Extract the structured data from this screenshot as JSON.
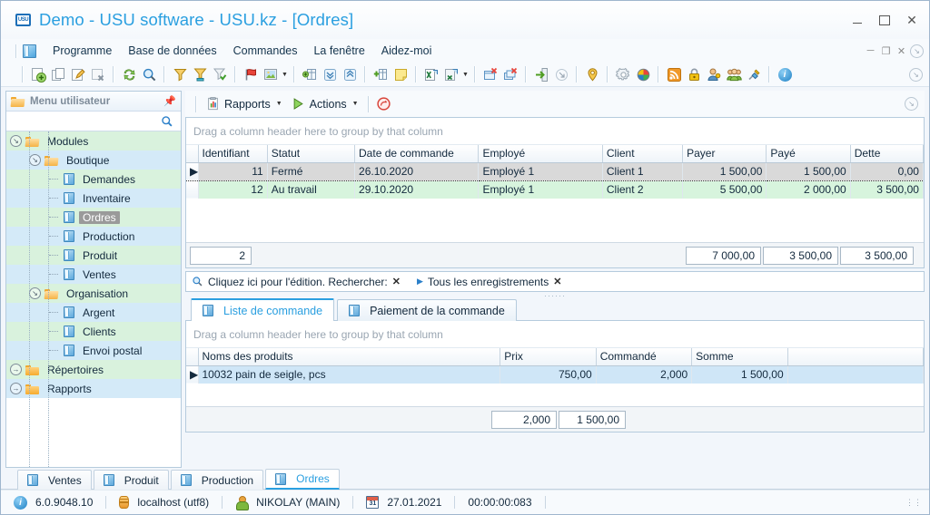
{
  "window": {
    "title": "Demo - USU software - USU.kz - [Ordres]",
    "app_icon": "usu",
    "minimize": "–",
    "maximize": "□",
    "close": "×"
  },
  "menubar": {
    "items": [
      "Programme",
      "Base de données",
      "Commandes",
      "La fenêtre",
      "Aidez-moi"
    ],
    "mdi_buttons": [
      "–",
      "❐",
      "×",
      "⤵"
    ]
  },
  "toolbar": {
    "groups": [
      [
        "add-record-icon",
        "copy-record-icon",
        "edit-record-icon",
        "delete-record-icon"
      ],
      [
        "refresh-icon",
        "search-icon"
      ],
      [
        "filter-icon",
        "filter-award-icon",
        "filter-check-icon"
      ],
      [
        "flag-icon",
        "image-icon"
      ],
      [
        "group-expand-icon",
        "collapse-all-icon",
        "expand-all-icon"
      ],
      [
        "add-column-icon",
        "note-icon"
      ],
      [
        "export-excel-icon",
        "export-excel-dropdown-icon"
      ],
      [
        "close-window-icon",
        "close-all-icon"
      ],
      [
        "exit-icon",
        "minimize-panel-icon"
      ],
      [
        "pin-location-icon"
      ],
      [
        "settings-icon",
        "theme-color-icon"
      ],
      [
        "rss-icon",
        "lock-icon",
        "user-key-icon",
        "users-icon",
        "plug-icon"
      ],
      [
        "info-icon"
      ]
    ],
    "collapse_label": "⤵"
  },
  "sidebar": {
    "title": "Menu utilisateur",
    "pin_icon": "pin-icon",
    "search_icon": "search-icon",
    "tree": [
      {
        "label": "Modules",
        "level": 0,
        "type": "folder-open",
        "expanded": true,
        "band": "g0",
        "selected": false
      },
      {
        "label": "Boutique",
        "level": 1,
        "type": "folder-open",
        "expanded": true,
        "band": "g1",
        "selected": false
      },
      {
        "label": "Demandes",
        "level": 2,
        "type": "doc",
        "expanded": null,
        "band": "g0",
        "selected": false
      },
      {
        "label": "Inventaire",
        "level": 2,
        "type": "doc",
        "expanded": null,
        "band": "g1",
        "selected": false
      },
      {
        "label": "Ordres",
        "level": 2,
        "type": "doc",
        "expanded": null,
        "band": "g0",
        "selected": true
      },
      {
        "label": "Production",
        "level": 2,
        "type": "doc",
        "expanded": null,
        "band": "g1",
        "selected": false
      },
      {
        "label": "Produit",
        "level": 2,
        "type": "doc",
        "expanded": null,
        "band": "g0",
        "selected": false
      },
      {
        "label": "Ventes",
        "level": 2,
        "type": "doc",
        "expanded": null,
        "band": "g1",
        "selected": false
      },
      {
        "label": "Organisation",
        "level": 1,
        "type": "folder-open",
        "expanded": true,
        "band": "g0",
        "selected": false
      },
      {
        "label": "Argent",
        "level": 2,
        "type": "doc",
        "expanded": null,
        "band": "g1",
        "selected": false
      },
      {
        "label": "Clients",
        "level": 2,
        "type": "doc",
        "expanded": null,
        "band": "g0",
        "selected": false
      },
      {
        "label": "Envoi postal",
        "level": 2,
        "type": "doc",
        "expanded": null,
        "band": "g1",
        "selected": false
      },
      {
        "label": "Répertoires",
        "level": 0,
        "type": "folder",
        "expanded": false,
        "band": "g0",
        "selected": false
      },
      {
        "label": "Rapports",
        "level": 0,
        "type": "folder",
        "expanded": false,
        "band": "g1",
        "selected": false
      }
    ]
  },
  "subtoolbar": {
    "reports_label": "Rapports",
    "reports_icon": "report-icon",
    "actions_label": "Actions",
    "actions_icon": "play-icon",
    "cancel_icon": "cancel-icon",
    "caret": "▼",
    "collapse_label": "⤵"
  },
  "orders_grid": {
    "group_hint": "Drag a column header here to group by that column",
    "columns": [
      {
        "label": "Identifiant",
        "align": "num",
        "width": "9.5%"
      },
      {
        "label": "Statut",
        "align": "text",
        "width": "12%"
      },
      {
        "label": "Date de commande",
        "align": "text",
        "width": "17%"
      },
      {
        "label": "Employé",
        "align": "text",
        "width": "17%"
      },
      {
        "label": "Client",
        "align": "text",
        "width": "11%"
      },
      {
        "label": "Payer",
        "align": "num",
        "width": "11.5%"
      },
      {
        "label": "Payé",
        "align": "num",
        "width": "11.5%"
      },
      {
        "label": "Dette",
        "align": "num",
        "width": "10%"
      }
    ],
    "rows": [
      {
        "selected": true,
        "cells": [
          "11",
          "Fermé",
          "26.10.2020",
          "Employé 1",
          "Client 1",
          "1 500,00",
          "1 500,00",
          "0,00"
        ]
      },
      {
        "selected": false,
        "cells": [
          "12",
          "Au travail",
          "29.10.2020",
          "Employé 1",
          "Client 2",
          "5 500,00",
          "2 000,00",
          "3 500,00"
        ]
      }
    ],
    "summary": {
      "count": "2",
      "payer": "7 000,00",
      "paye": "3 500,00",
      "dette": "3 500,00"
    }
  },
  "filterbar": {
    "search_icon": "search-icon",
    "text": "Cliquez ici pour l'édition. Rechercher:",
    "clear_icon": "✕",
    "play_icon": "▶",
    "all_records": "Tous les enregistrements",
    "all_records_clear": "✕"
  },
  "detail_tabs": [
    {
      "label": "Liste de commande",
      "icon": "document-icon",
      "active": true
    },
    {
      "label": "Paiement de la commande",
      "icon": "document-icon",
      "active": false
    }
  ],
  "detail_grid": {
    "group_hint": "Drag a column header here to group by that column",
    "columns": [
      {
        "label": "Noms des produits",
        "align": "text",
        "width": "41%"
      },
      {
        "label": "Prix",
        "align": "num",
        "width": "13%"
      },
      {
        "label": "Commandé",
        "align": "num",
        "width": "13%"
      },
      {
        "label": "Somme",
        "align": "num",
        "width": "13%"
      }
    ],
    "rows": [
      {
        "selected": true,
        "cells": [
          "10032 pain de seigle, pcs",
          "750,00",
          "2,000",
          "1 500,00"
        ]
      }
    ],
    "summary": {
      "commande": "2,000",
      "somme": "1 500,00"
    }
  },
  "doc_tabs": [
    {
      "label": "Ventes",
      "icon": "document-icon",
      "active": false
    },
    {
      "label": "Produit",
      "icon": "document-icon",
      "active": false
    },
    {
      "label": "Production",
      "icon": "document-icon",
      "active": false
    },
    {
      "label": "Ordres",
      "icon": "document-icon",
      "active": true
    }
  ],
  "statusbar": {
    "version": "6.0.9048.10",
    "version_icon": "info-icon",
    "server": "localhost (utf8)",
    "server_icon": "database-icon",
    "user": "NIKOLAY (MAIN)",
    "user_icon": "user-icon",
    "date": "27.01.2021",
    "date_icon": "calendar-icon",
    "elapsed": "00:00:00:083",
    "grip_icon": "resize-grip-icon"
  },
  "colors": {
    "accent": "#2a9fe0",
    "title": "#2a9fe0",
    "tree_green": "#d9f2dd",
    "tree_blue": "#d4eaf8",
    "row_green": "#d7f4dd",
    "row_selected": "#d9d9d9",
    "detail_row_selected": "#cfe6f7",
    "panel_border": "#b5cbdd"
  }
}
